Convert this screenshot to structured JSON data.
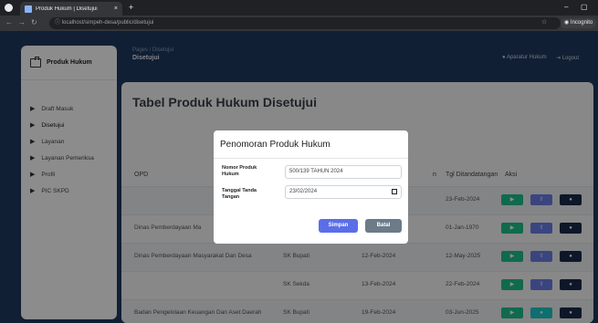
{
  "browser": {
    "tab_title": "Produk Hukum | Disetujui",
    "tab_close": "×",
    "new_tab": "+",
    "url": "localhost/simpeh-desa/public/disetujui",
    "profile_label": "Incognito",
    "win_minimize": "–",
    "win_restore": "▢"
  },
  "sidebar": {
    "brand": "Produk Hukum",
    "items": [
      {
        "label": "Draft Masuk"
      },
      {
        "label": "Disetujui"
      },
      {
        "label": "Layanan"
      },
      {
        "label": "Layanan Pemeriksa"
      },
      {
        "label": "Profil"
      },
      {
        "label": "PIC SKPD"
      }
    ]
  },
  "header": {
    "breadcrumb": "Pages / Disetujui",
    "title": "Disetujui",
    "admin": "Aparatur Hukum",
    "logout": "Logout"
  },
  "main": {
    "title": "Tabel Produk Hukum Disetujui",
    "columns": [
      "OPD",
      "n",
      "Tgl Ditandatangan",
      "Aksi"
    ],
    "rows": [
      {
        "opd": "",
        "jenis": "",
        "tgl1": "",
        "tgl2": "23-Feb-2024"
      },
      {
        "opd": "Dinas Pemberdayaan Ma",
        "jenis": "",
        "tgl1": "",
        "tgl2": "01-Jan-1970"
      },
      {
        "opd": "Dinas Pemberdayaan Masyarakat Dan Desa",
        "jenis": "SK Bupati",
        "tgl1": "12-Feb-2024",
        "tgl2": "12-May-2025"
      },
      {
        "opd": "",
        "jenis": "SK Sekda",
        "tgl1": "13-Feb-2024",
        "tgl2": "22-Feb-2024"
      },
      {
        "opd": "Badan Pengelolaan Keuangan Dan Aset Daerah",
        "jenis": "SK Bupati",
        "tgl1": "19-Feb-2024",
        "tgl2": "03-Jun-2025"
      }
    ]
  },
  "modal": {
    "title": "Penomoran Produk Hukum",
    "nomor_label": "Nomor Produk Hukum",
    "nomor_value": "500/139 TAHUN 2024",
    "tanggal_label": "Tanggal Tanda Tangan",
    "tanggal_value": "23/02/2024",
    "save_label": "Simpan",
    "cancel_label": "Batal"
  },
  "colors": {
    "page_bg": "#1f3a5f",
    "btn_green": "#1ec28b",
    "btn_blue": "#6a7ee8",
    "btn_dark": "#1b2a4a",
    "btn_teal": "#1ec8c8",
    "save": "#5b6ee8",
    "cancel": "#6c7a89"
  }
}
